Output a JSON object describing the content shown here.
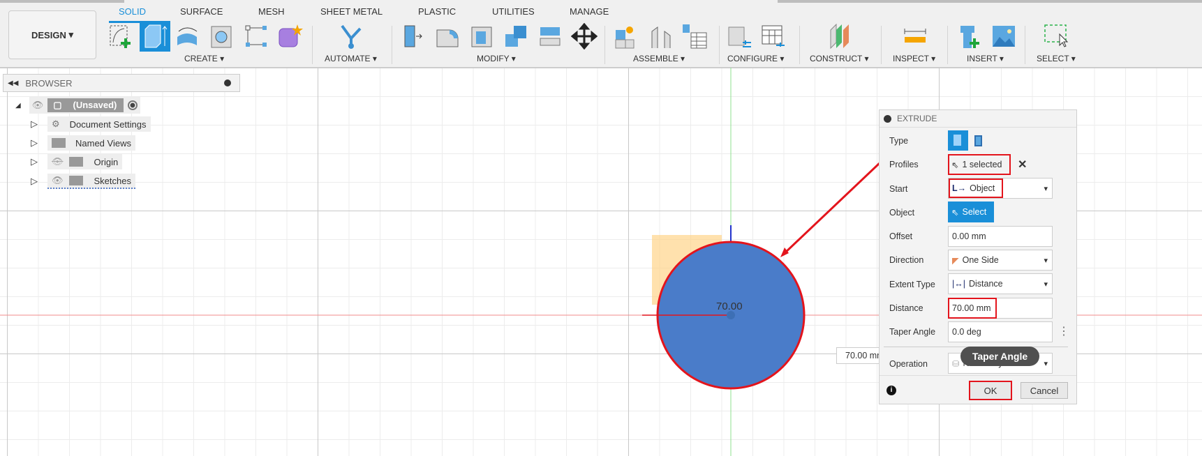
{
  "toolbar": {
    "workspace": "DESIGN",
    "tabs": [
      "SOLID",
      "SURFACE",
      "MESH",
      "SHEET METAL",
      "PLASTIC",
      "UTILITIES",
      "MANAGE"
    ],
    "groups": [
      "CREATE",
      "AUTOMATE",
      "MODIFY",
      "ASSEMBLE",
      "CONFIGURE",
      "CONSTRUCT",
      "INSPECT",
      "INSERT",
      "SELECT"
    ]
  },
  "browser": {
    "title": "BROWSER",
    "root": "(Unsaved)",
    "items": [
      "Document Settings",
      "Named Views",
      "Origin",
      "Sketches"
    ]
  },
  "canvas": {
    "dimension_label": "70.00",
    "dimension_input": "70.00 mm"
  },
  "extrude": {
    "title": "EXTRUDE",
    "labels": {
      "type": "Type",
      "profiles": "Profiles",
      "start": "Start",
      "object": "Object",
      "offset": "Offset",
      "direction": "Direction",
      "extent": "Extent Type",
      "distance": "Distance",
      "taper": "Taper Angle",
      "operation": "Operation"
    },
    "values": {
      "profiles": "1 selected",
      "start": "Object",
      "object": "Select",
      "offset": "0.00 mm",
      "direction": "One Side",
      "extent": "Distance",
      "distance": "70.00 mm",
      "taper": "0.0 deg",
      "operation": "New Body"
    },
    "ok": "OK",
    "cancel": "Cancel",
    "tooltip": "Taper Angle"
  },
  "colors": {
    "accent": "#1a8fd8",
    "highlight": "#e3141c",
    "profile": "#4a7cc9"
  }
}
